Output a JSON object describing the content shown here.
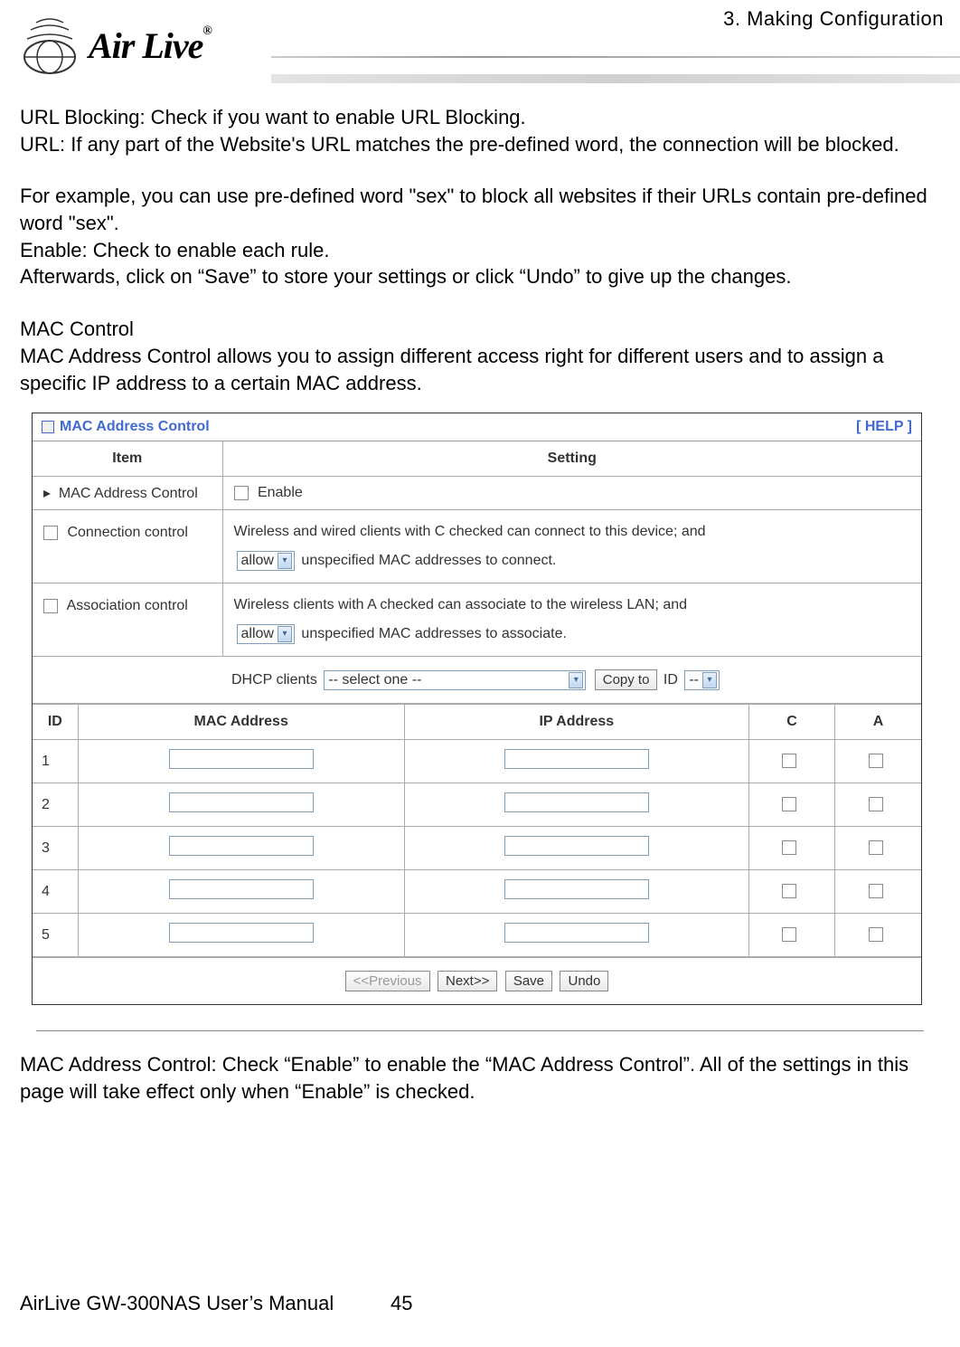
{
  "header": {
    "chapter": "3.  Making  Configuration",
    "brand": "Air Live",
    "brand_r": "®"
  },
  "body": {
    "p1": "URL Blocking: Check if you want to enable URL Blocking.",
    "p2": "URL: If any part of the Website's URL matches the pre-defined word, the connection will be blocked.",
    "p3": "For example, you can use pre-defined word \"sex\" to block all websites if their URLs contain pre-defined word \"sex\".",
    "p4": "Enable: Check to enable each rule.",
    "p5": "Afterwards, click on “Save” to store your settings or click “Undo” to give up the changes.",
    "p6": "MAC Control",
    "p7": "MAC Address Control allows you to assign different access right for different users and to assign a specific IP address to a certain MAC address.",
    "p_after": "MAC Address Control: Check “Enable” to enable the “MAC Address Control”. All of the settings in this page will take effect only when “Enable” is checked."
  },
  "panel": {
    "title": "MAC Address Control",
    "help": "[ HELP ]",
    "th_item": "Item",
    "th_setting": "Setting",
    "row1_label": "MAC Address Control",
    "row1_enable": "Enable",
    "row2_label": "Connection control",
    "row2_text1": "Wireless and wired clients with C checked can connect to this device; and",
    "row2_select": "allow",
    "row2_text2": "unspecified MAC addresses to connect.",
    "row3_label": "Association control",
    "row3_text1": "Wireless clients with A checked can associate to the wireless LAN; and",
    "row3_select": "allow",
    "row3_text2": "unspecified MAC addresses to associate.",
    "dhcp_label": "DHCP clients",
    "dhcp_select": "-- select one --",
    "dhcp_copy": "Copy to",
    "dhcp_id": "ID",
    "dhcp_id_select": "--",
    "cols": {
      "id": "ID",
      "mac": "MAC Address",
      "ip": "IP Address",
      "c": "C",
      "a": "A"
    },
    "rows": [
      "1",
      "2",
      "3",
      "4",
      "5"
    ],
    "nav": {
      "prev": "<<Previous",
      "next": "Next>>",
      "save": "Save",
      "undo": "Undo"
    }
  },
  "footer": {
    "manual": "AirLive GW-300NAS User’s Manual",
    "page": "45"
  }
}
